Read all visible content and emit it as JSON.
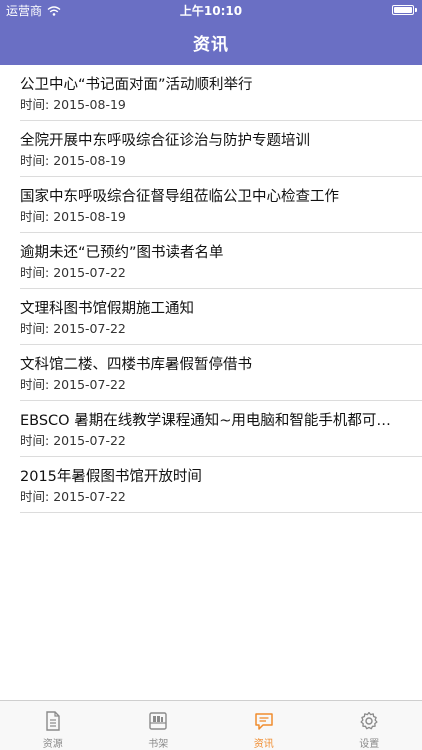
{
  "status_bar": {
    "carrier": "运营商",
    "time": "上午10:10"
  },
  "nav": {
    "title": "资讯"
  },
  "time_prefix": "时间:",
  "news": [
    {
      "title": "公卫中心“书记面对面”活动顺利举行",
      "date": "2015-08-19"
    },
    {
      "title": "全院开展中东呼吸综合征诊治与防护专题培训",
      "date": "2015-08-19"
    },
    {
      "title": "国家中东呼吸综合征督导组莅临公卫中心检查工作",
      "date": "2015-08-19"
    },
    {
      "title": "逾期未还“已预约”图书读者名单",
      "date": "2015-07-22"
    },
    {
      "title": "文理科图书馆假期施工通知",
      "date": "2015-07-22"
    },
    {
      "title": "文科馆二楼、四楼书库暑假暂停借书",
      "date": "2015-07-22"
    },
    {
      "title": "EBSCO 暑期在线教学课程通知~用电脑和智能手机都可以...",
      "date": "2015-07-22"
    },
    {
      "title": "2015年暑假图书馆开放时间",
      "date": "2015-07-22"
    }
  ],
  "tabs": [
    {
      "label": "资源",
      "icon": "document-icon"
    },
    {
      "label": "书架",
      "icon": "bookshelf-icon"
    },
    {
      "label": "资讯",
      "icon": "message-icon"
    },
    {
      "label": "设置",
      "icon": "gear-icon"
    }
  ],
  "colors": {
    "accent": "#6a6fc4",
    "active_tab": "#f08c2e",
    "inactive_tab": "#8a8a8a"
  }
}
